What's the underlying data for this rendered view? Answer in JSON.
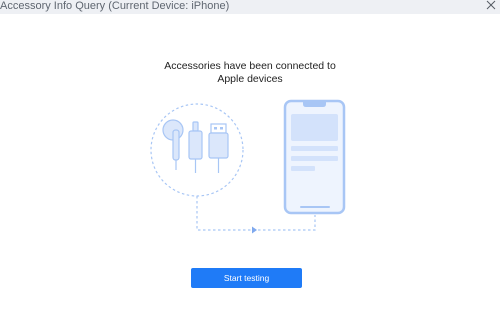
{
  "window": {
    "title": "Accessory Info Query (Current Device: iPhone)",
    "close_icon": "close-icon"
  },
  "main": {
    "heading": "Accessories have been connected to Apple devices",
    "start_button_label": "Start testing"
  },
  "illustration": {
    "accessories": [
      "earphone-icon",
      "lightning-plug-icon",
      "usb-plug-icon"
    ],
    "device": "iphone-icon",
    "connector": "arrow-right-icon"
  },
  "colors": {
    "accent": "#1f7bf7",
    "illustration_stroke": "#a8c6f5",
    "illustration_fill": "#dbe7fb",
    "titlebar_bg": "#eef0f4"
  }
}
